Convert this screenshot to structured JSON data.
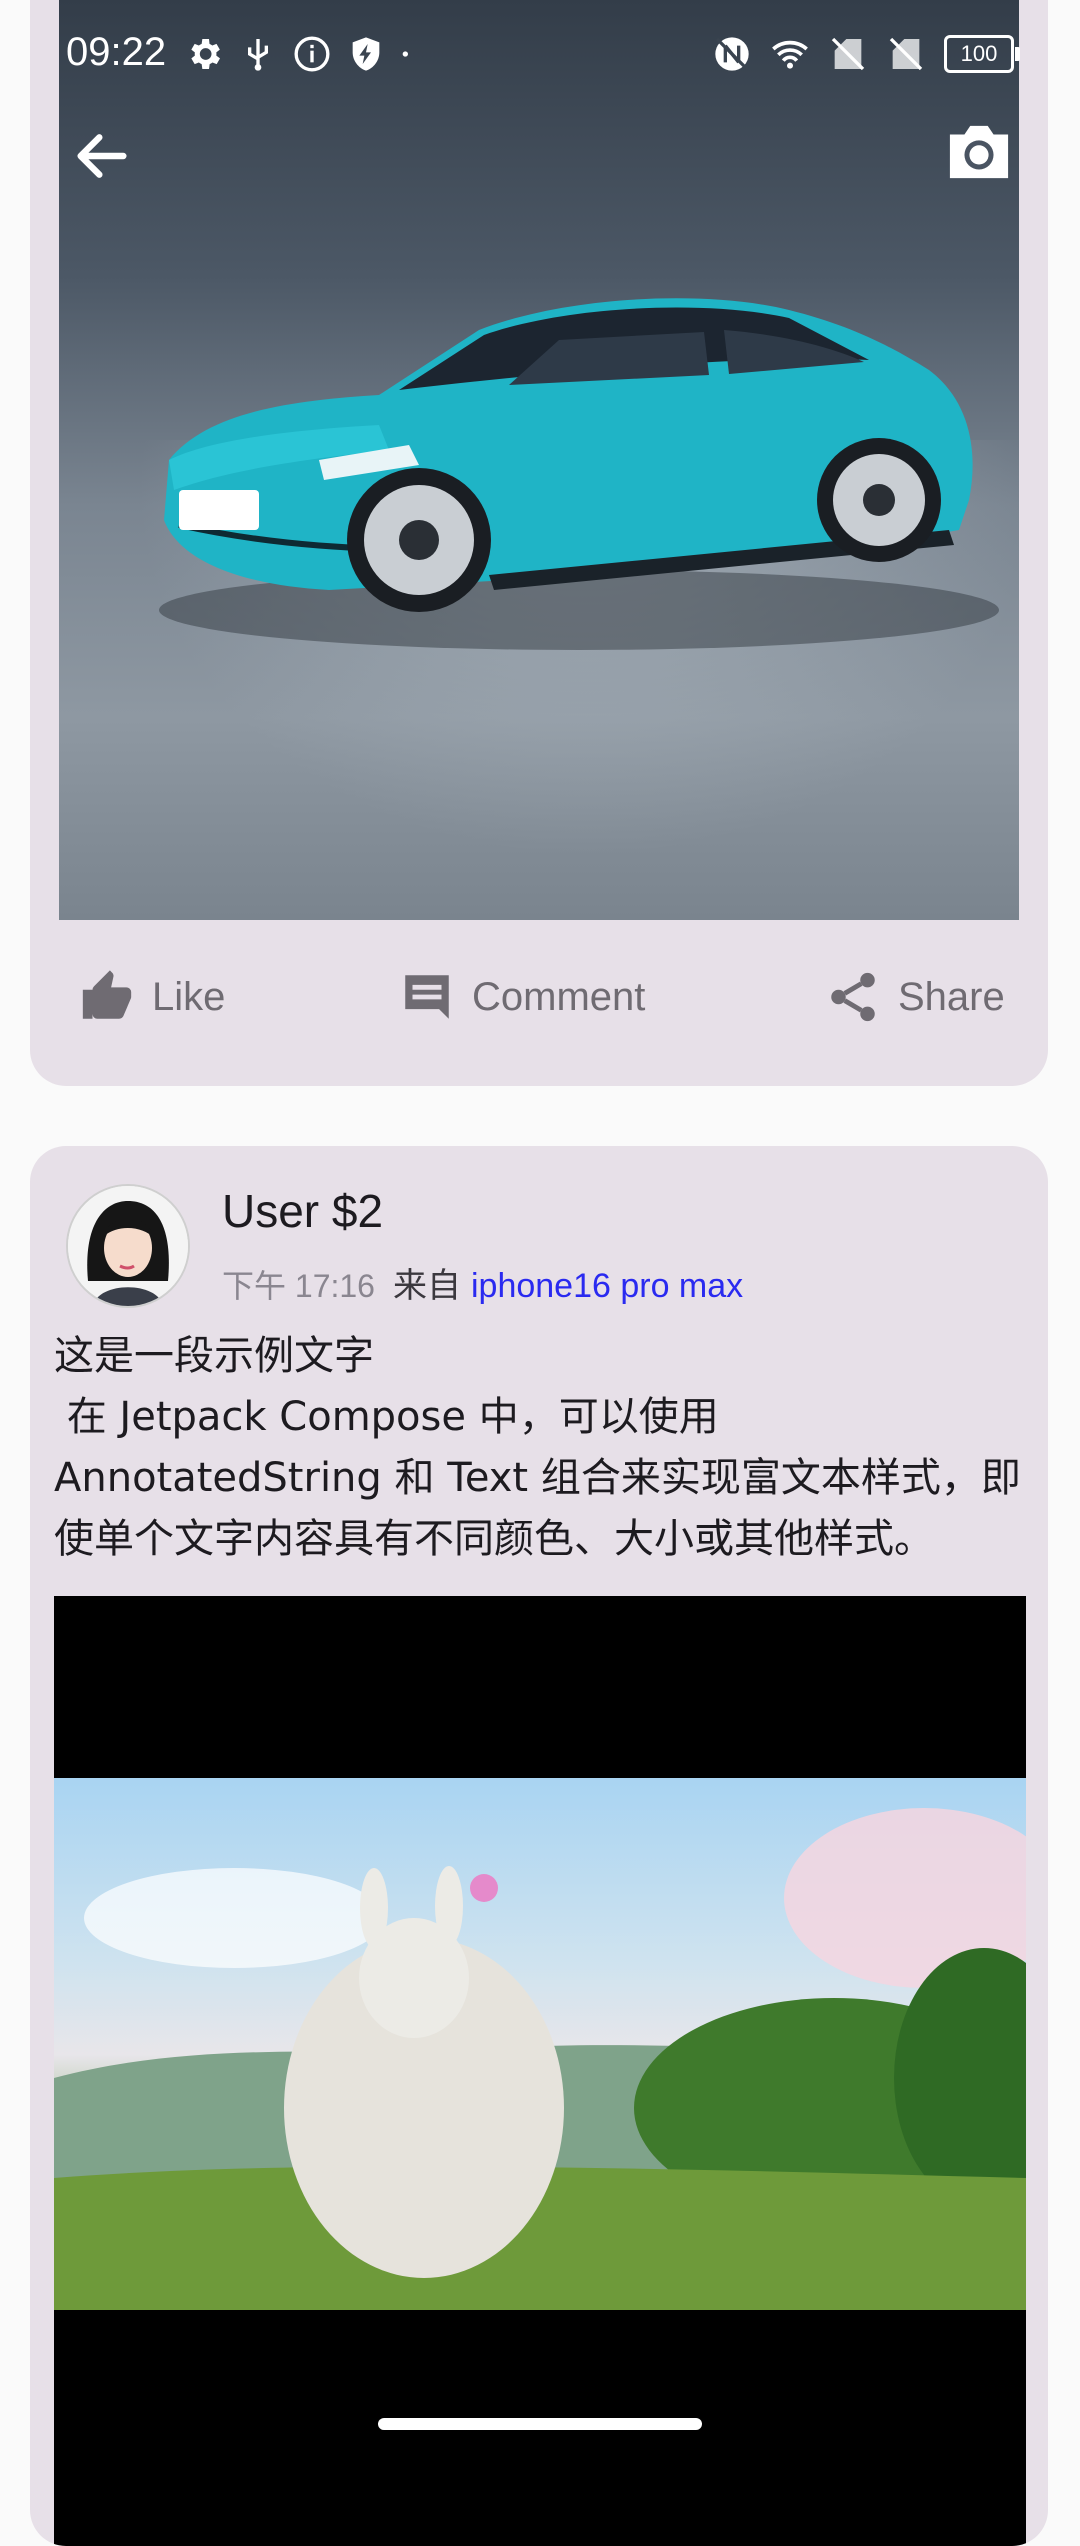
{
  "status_bar": {
    "time": "09:22",
    "left_icons": [
      "gear-icon",
      "usb-icon",
      "info-icon",
      "shield-bolt-icon",
      "dot-icon"
    ],
    "right_icons": [
      "nfc-icon",
      "wifi-icon",
      "no-sim-icon",
      "no-sim-icon"
    ],
    "battery": "100"
  },
  "toolbar": {
    "back_icon": "arrow-left-icon",
    "camera_icon": "camera-icon"
  },
  "post1": {
    "actions": [
      {
        "label": "Like",
        "icon": "thumb-up-icon"
      },
      {
        "label": "Comment",
        "icon": "comment-icon"
      },
      {
        "label": "Share",
        "icon": "share-icon"
      }
    ]
  },
  "post2": {
    "username": "User $2",
    "time": "下午 17:16",
    "from_label": "来自",
    "device": "iphone16 pro max",
    "text": "这是一段示例文字\n 在 Jetpack Compose 中，可以使用 AnnotatedString 和 Text 组合来实现富文本样式，即使单个文字内容具有不同颜色、大小或其他样式。"
  },
  "colors": {
    "card_bg": "#e7e0e8",
    "page_bg": "#fafafa",
    "link": "#2a2af0",
    "action_text": "#6f6b72"
  }
}
